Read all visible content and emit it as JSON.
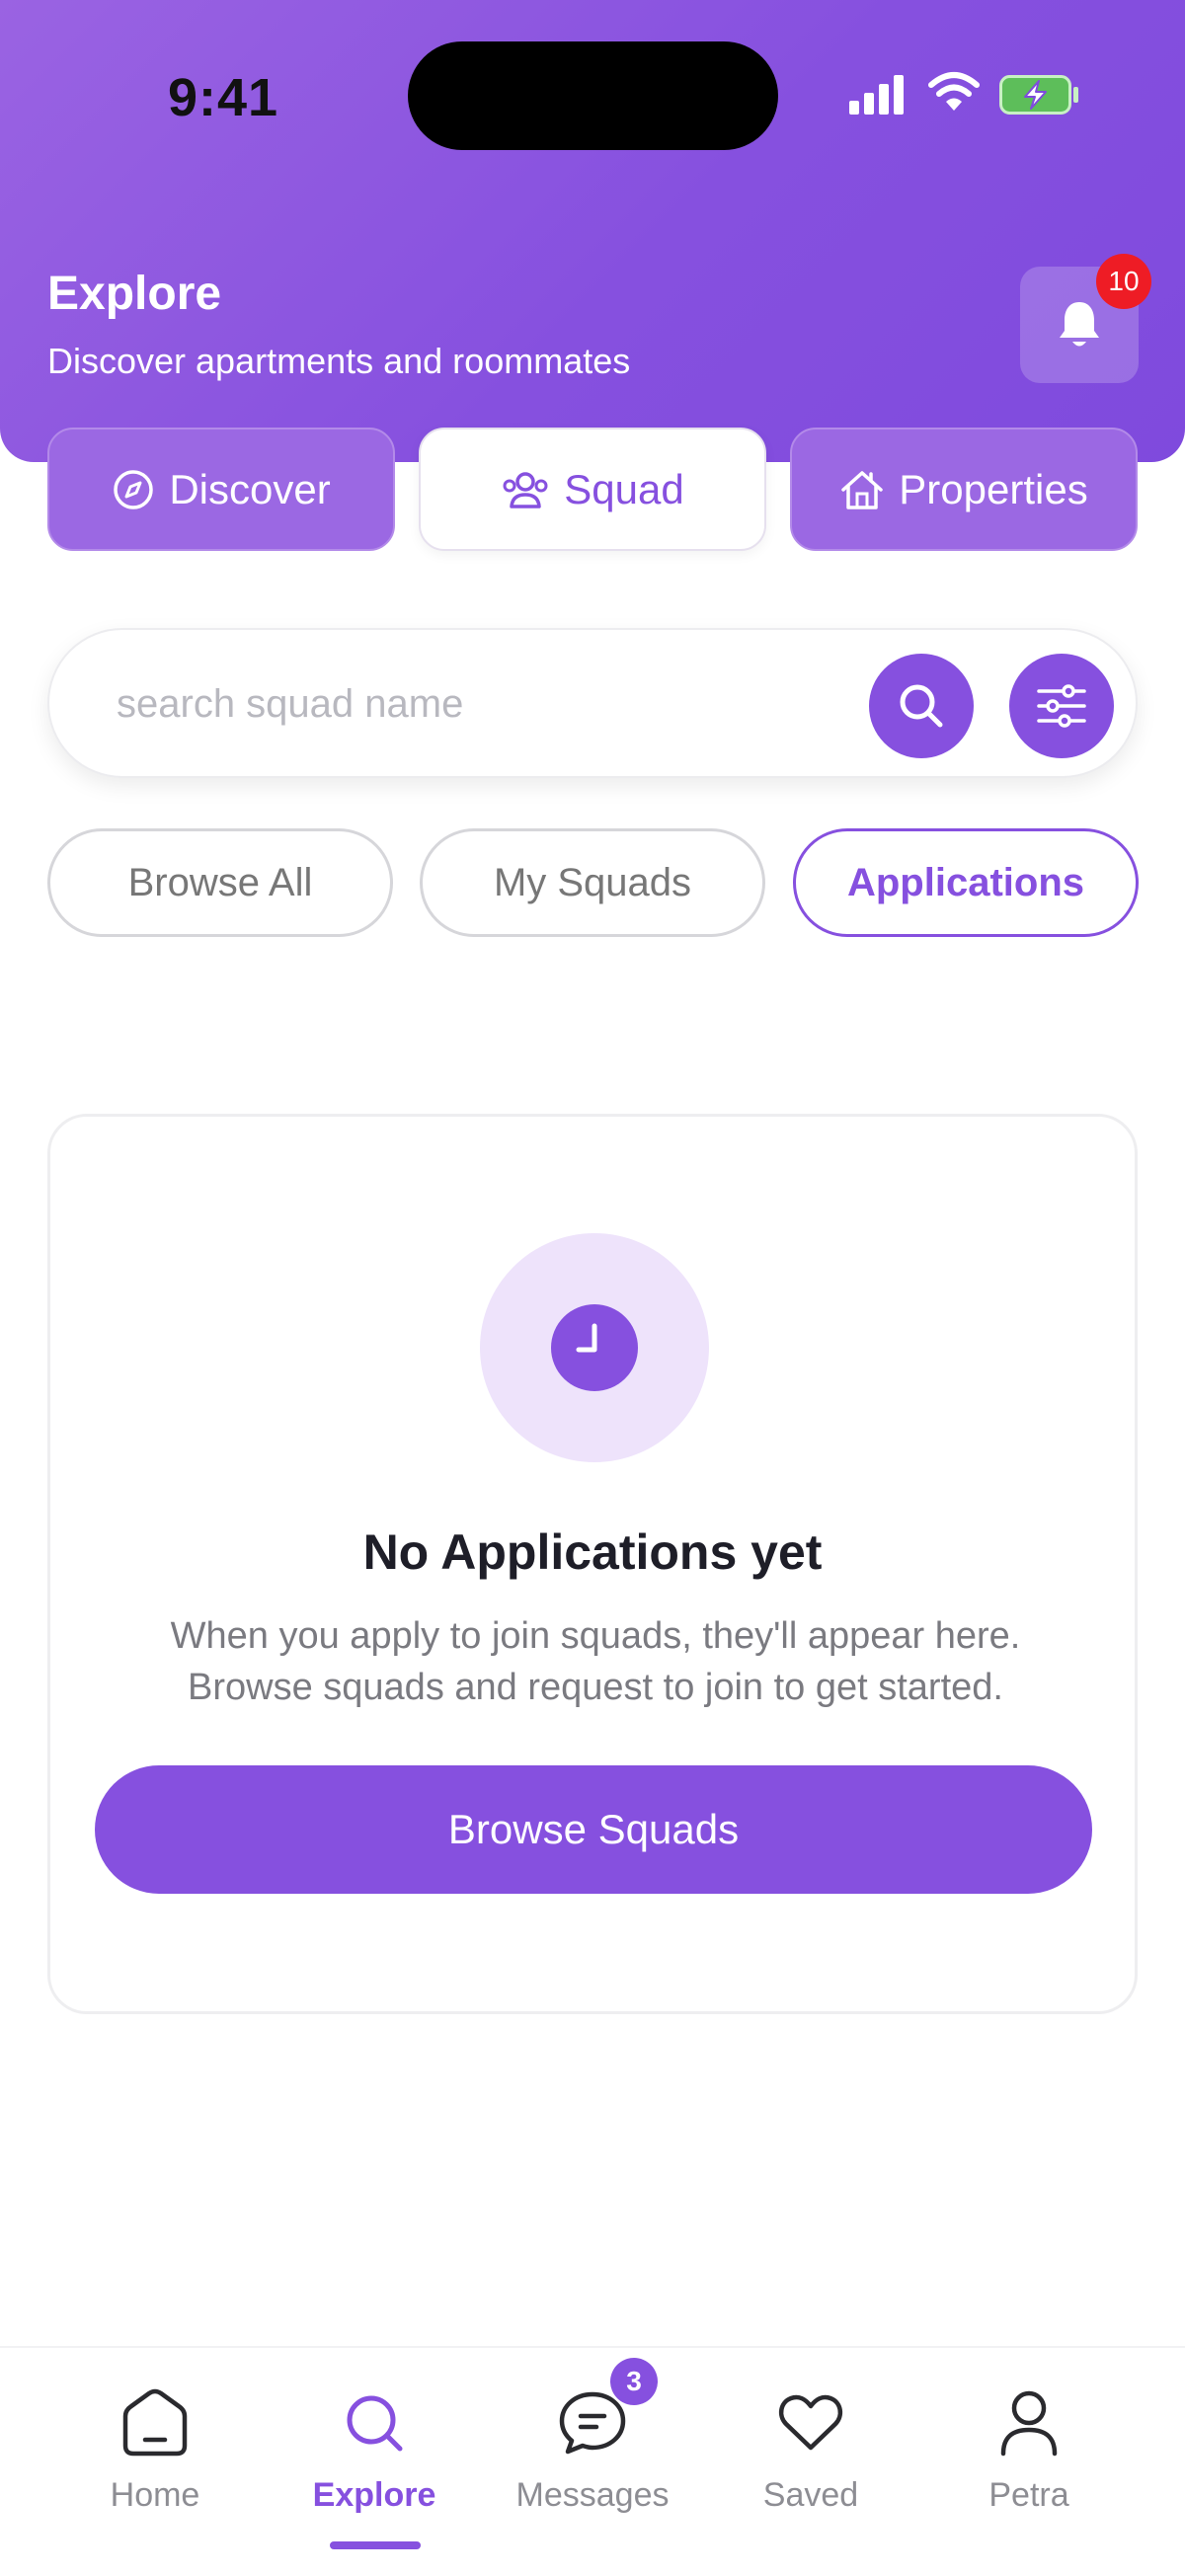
{
  "status_bar": {
    "time": "9:41"
  },
  "header": {
    "title": "Explore",
    "subtitle": "Discover apartments and roommates",
    "notification_count": "10"
  },
  "segments": [
    {
      "label": "Discover",
      "icon": "compass-icon",
      "active": false
    },
    {
      "label": "Squad",
      "icon": "users-icon",
      "active": true
    },
    {
      "label": "Properties",
      "icon": "house-icon",
      "active": false
    }
  ],
  "search": {
    "placeholder": "search squad name",
    "value": ""
  },
  "filters": [
    {
      "label": "Browse All",
      "active": false
    },
    {
      "label": "My Squads",
      "active": false
    },
    {
      "label": "Applications",
      "active": true
    }
  ],
  "empty_state": {
    "icon": "clock-icon",
    "title": "No Applications yet",
    "description": "When you apply to join squads, they'll appear here. Browse squads and request to join to get started.",
    "button_label": "Browse Squads"
  },
  "bottom_nav": {
    "items": [
      {
        "label": "Home",
        "icon": "home-icon"
      },
      {
        "label": "Explore",
        "icon": "search-icon",
        "active": true
      },
      {
        "label": "Messages",
        "icon": "chat-icon",
        "badge": "3"
      },
      {
        "label": "Saved",
        "icon": "heart-icon"
      },
      {
        "label": "Petra",
        "icon": "user-icon"
      }
    ]
  },
  "colors": {
    "accent": "#8650DF",
    "badge_red": "#EE1C25",
    "battery_green": "#5DBE5A"
  }
}
